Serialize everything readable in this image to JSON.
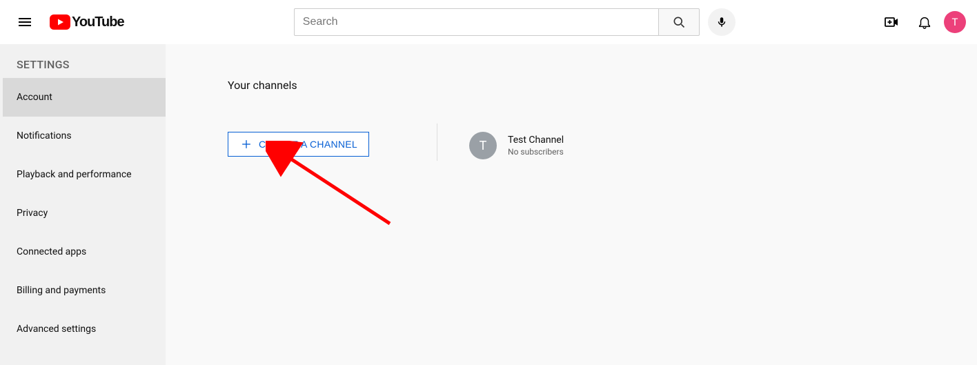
{
  "header": {
    "logo_text": "YouTube",
    "search_placeholder": "Search",
    "avatar_letter": "T"
  },
  "sidebar": {
    "title": "SETTINGS",
    "items": [
      {
        "label": "Account",
        "active": true
      },
      {
        "label": "Notifications",
        "active": false
      },
      {
        "label": "Playback and performance",
        "active": false
      },
      {
        "label": "Privacy",
        "active": false
      },
      {
        "label": "Connected apps",
        "active": false
      },
      {
        "label": "Billing and payments",
        "active": false
      },
      {
        "label": "Advanced settings",
        "active": false
      }
    ]
  },
  "main": {
    "title": "Your channels",
    "create_button": "CREATE A CHANNEL",
    "channel": {
      "avatar_letter": "T",
      "name": "Test Channel",
      "subscribers": "No subscribers"
    }
  },
  "colors": {
    "brand_red": "#FF0000",
    "link_blue": "#065fd4",
    "avatar_pink": "#ec407a",
    "gray_avatar": "#9aa0a6"
  }
}
